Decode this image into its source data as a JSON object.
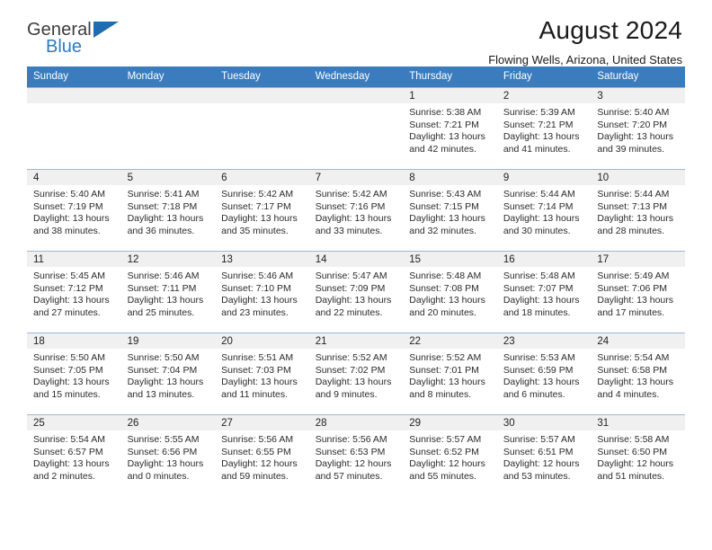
{
  "brand": {
    "name_top": "General",
    "name_bottom": "Blue",
    "triangle_color": "#1f6cb0"
  },
  "header": {
    "title": "August 2024",
    "subtitle": "Flowing Wells, Arizona, United States"
  },
  "colors": {
    "header_bar": "#3a7cbe",
    "daynum_band": "#f0f0f0",
    "row_divider": "#9fb8d0",
    "brand_blue": "#2b7cc4"
  },
  "weekdays": [
    "Sunday",
    "Monday",
    "Tuesday",
    "Wednesday",
    "Thursday",
    "Friday",
    "Saturday"
  ],
  "labels": {
    "sunrise_prefix": "Sunrise:",
    "sunset_prefix": "Sunset:",
    "daylight_prefix": "Daylight:"
  },
  "weeks": [
    [
      {
        "empty": true
      },
      {
        "empty": true
      },
      {
        "empty": true
      },
      {
        "empty": true
      },
      {
        "day": "1",
        "sunrise": "Sunrise: 5:38 AM",
        "sunset": "Sunset: 7:21 PM",
        "daylight": "Daylight: 13 hours and 42 minutes."
      },
      {
        "day": "2",
        "sunrise": "Sunrise: 5:39 AM",
        "sunset": "Sunset: 7:21 PM",
        "daylight": "Daylight: 13 hours and 41 minutes."
      },
      {
        "day": "3",
        "sunrise": "Sunrise: 5:40 AM",
        "sunset": "Sunset: 7:20 PM",
        "daylight": "Daylight: 13 hours and 39 minutes."
      }
    ],
    [
      {
        "day": "4",
        "sunrise": "Sunrise: 5:40 AM",
        "sunset": "Sunset: 7:19 PM",
        "daylight": "Daylight: 13 hours and 38 minutes."
      },
      {
        "day": "5",
        "sunrise": "Sunrise: 5:41 AM",
        "sunset": "Sunset: 7:18 PM",
        "daylight": "Daylight: 13 hours and 36 minutes."
      },
      {
        "day": "6",
        "sunrise": "Sunrise: 5:42 AM",
        "sunset": "Sunset: 7:17 PM",
        "daylight": "Daylight: 13 hours and 35 minutes."
      },
      {
        "day": "7",
        "sunrise": "Sunrise: 5:42 AM",
        "sunset": "Sunset: 7:16 PM",
        "daylight": "Daylight: 13 hours and 33 minutes."
      },
      {
        "day": "8",
        "sunrise": "Sunrise: 5:43 AM",
        "sunset": "Sunset: 7:15 PM",
        "daylight": "Daylight: 13 hours and 32 minutes."
      },
      {
        "day": "9",
        "sunrise": "Sunrise: 5:44 AM",
        "sunset": "Sunset: 7:14 PM",
        "daylight": "Daylight: 13 hours and 30 minutes."
      },
      {
        "day": "10",
        "sunrise": "Sunrise: 5:44 AM",
        "sunset": "Sunset: 7:13 PM",
        "daylight": "Daylight: 13 hours and 28 minutes."
      }
    ],
    [
      {
        "day": "11",
        "sunrise": "Sunrise: 5:45 AM",
        "sunset": "Sunset: 7:12 PM",
        "daylight": "Daylight: 13 hours and 27 minutes."
      },
      {
        "day": "12",
        "sunrise": "Sunrise: 5:46 AM",
        "sunset": "Sunset: 7:11 PM",
        "daylight": "Daylight: 13 hours and 25 minutes."
      },
      {
        "day": "13",
        "sunrise": "Sunrise: 5:46 AM",
        "sunset": "Sunset: 7:10 PM",
        "daylight": "Daylight: 13 hours and 23 minutes."
      },
      {
        "day": "14",
        "sunrise": "Sunrise: 5:47 AM",
        "sunset": "Sunset: 7:09 PM",
        "daylight": "Daylight: 13 hours and 22 minutes."
      },
      {
        "day": "15",
        "sunrise": "Sunrise: 5:48 AM",
        "sunset": "Sunset: 7:08 PM",
        "daylight": "Daylight: 13 hours and 20 minutes."
      },
      {
        "day": "16",
        "sunrise": "Sunrise: 5:48 AM",
        "sunset": "Sunset: 7:07 PM",
        "daylight": "Daylight: 13 hours and 18 minutes."
      },
      {
        "day": "17",
        "sunrise": "Sunrise: 5:49 AM",
        "sunset": "Sunset: 7:06 PM",
        "daylight": "Daylight: 13 hours and 17 minutes."
      }
    ],
    [
      {
        "day": "18",
        "sunrise": "Sunrise: 5:50 AM",
        "sunset": "Sunset: 7:05 PM",
        "daylight": "Daylight: 13 hours and 15 minutes."
      },
      {
        "day": "19",
        "sunrise": "Sunrise: 5:50 AM",
        "sunset": "Sunset: 7:04 PM",
        "daylight": "Daylight: 13 hours and 13 minutes."
      },
      {
        "day": "20",
        "sunrise": "Sunrise: 5:51 AM",
        "sunset": "Sunset: 7:03 PM",
        "daylight": "Daylight: 13 hours and 11 minutes."
      },
      {
        "day": "21",
        "sunrise": "Sunrise: 5:52 AM",
        "sunset": "Sunset: 7:02 PM",
        "daylight": "Daylight: 13 hours and 9 minutes."
      },
      {
        "day": "22",
        "sunrise": "Sunrise: 5:52 AM",
        "sunset": "Sunset: 7:01 PM",
        "daylight": "Daylight: 13 hours and 8 minutes."
      },
      {
        "day": "23",
        "sunrise": "Sunrise: 5:53 AM",
        "sunset": "Sunset: 6:59 PM",
        "daylight": "Daylight: 13 hours and 6 minutes."
      },
      {
        "day": "24",
        "sunrise": "Sunrise: 5:54 AM",
        "sunset": "Sunset: 6:58 PM",
        "daylight": "Daylight: 13 hours and 4 minutes."
      }
    ],
    [
      {
        "day": "25",
        "sunrise": "Sunrise: 5:54 AM",
        "sunset": "Sunset: 6:57 PM",
        "daylight": "Daylight: 13 hours and 2 minutes."
      },
      {
        "day": "26",
        "sunrise": "Sunrise: 5:55 AM",
        "sunset": "Sunset: 6:56 PM",
        "daylight": "Daylight: 13 hours and 0 minutes."
      },
      {
        "day": "27",
        "sunrise": "Sunrise: 5:56 AM",
        "sunset": "Sunset: 6:55 PM",
        "daylight": "Daylight: 12 hours and 59 minutes."
      },
      {
        "day": "28",
        "sunrise": "Sunrise: 5:56 AM",
        "sunset": "Sunset: 6:53 PM",
        "daylight": "Daylight: 12 hours and 57 minutes."
      },
      {
        "day": "29",
        "sunrise": "Sunrise: 5:57 AM",
        "sunset": "Sunset: 6:52 PM",
        "daylight": "Daylight: 12 hours and 55 minutes."
      },
      {
        "day": "30",
        "sunrise": "Sunrise: 5:57 AM",
        "sunset": "Sunset: 6:51 PM",
        "daylight": "Daylight: 12 hours and 53 minutes."
      },
      {
        "day": "31",
        "sunrise": "Sunrise: 5:58 AM",
        "sunset": "Sunset: 6:50 PM",
        "daylight": "Daylight: 12 hours and 51 minutes."
      }
    ]
  ]
}
